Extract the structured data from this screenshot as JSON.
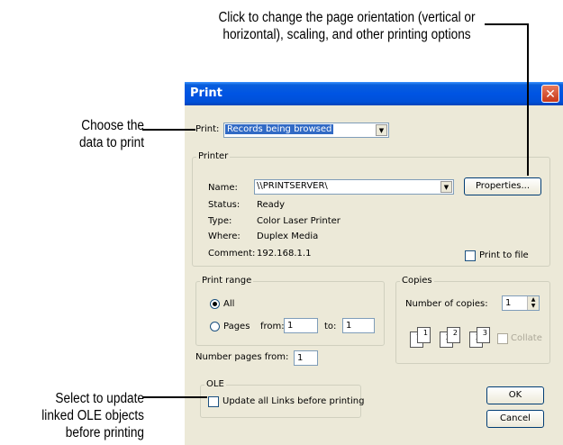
{
  "callouts": {
    "top_line1": "Click to change the page orientation (vertical or",
    "top_line2": "horizontal), scaling, and other printing options",
    "left1_line1": "Choose the",
    "left1_line2": "data to print",
    "left2_line1": "Select to update",
    "left2_line2": "linked OLE objects",
    "left2_line3": "before printing"
  },
  "dialog": {
    "title": "Print",
    "close_glyph": "✕",
    "print_label": "Print:",
    "print_value": "Records being browsed",
    "dropdown_glyph": "▼"
  },
  "printer": {
    "group_label": "Printer",
    "name_label": "Name:",
    "name_value": "\\\\PRINTSERVER\\",
    "properties_label": "Properties...",
    "status_label": "Status:",
    "status_value": "Ready",
    "type_label": "Type:",
    "type_value": "Color Laser Printer",
    "where_label": "Where:",
    "where_value": "Duplex Media",
    "comment_label": "Comment:",
    "comment_value": "192.168.1.1",
    "print_to_file_label": "Print to file",
    "print_to_file_checked": false
  },
  "range": {
    "group_label": "Print range",
    "all_label": "All",
    "pages_label": "Pages",
    "from_label": "from:",
    "from_value": "1",
    "to_label": "to:",
    "to_value": "1",
    "selected": "all"
  },
  "copies": {
    "group_label": "Copies",
    "number_label": "Number of copies:",
    "number_value": "1",
    "collate_label": "Collate",
    "pages": [
      "1",
      "1",
      "2",
      "2",
      "3",
      "3"
    ]
  },
  "number_pages": {
    "label": "Number pages from:",
    "value": "1"
  },
  "ole": {
    "group_label": "OLE",
    "update_label": "Update all Links before printing",
    "checked": false
  },
  "buttons": {
    "ok": "OK",
    "cancel": "Cancel"
  },
  "icons": [
    "close-icon",
    "dropdown-arrow-icon",
    "spinner-up-icon",
    "spinner-down-icon",
    "collate-pages-icon"
  ],
  "colors": {
    "titlebar": "#0054e3",
    "dialog_bg": "#ece9d8",
    "selection": "#316ac5",
    "close_button": "#c73818"
  }
}
